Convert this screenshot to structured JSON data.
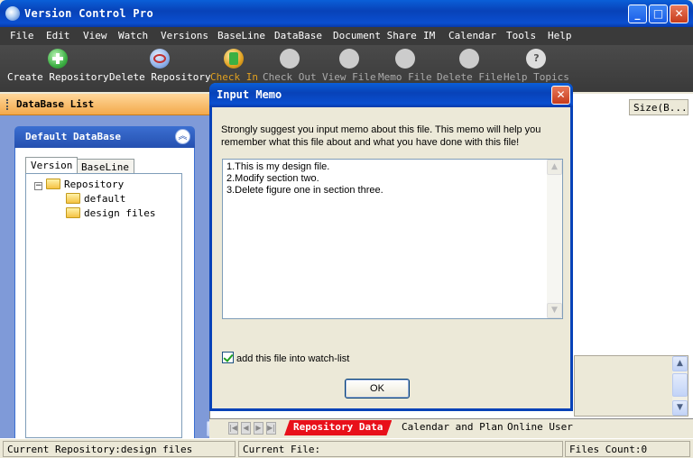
{
  "window": {
    "title": "Version Control Pro",
    "min_label": "_",
    "max_label": "□",
    "close_label": "✕"
  },
  "menu": [
    "File",
    "Edit",
    "View",
    "Watch",
    "Versions",
    "BaseLine",
    "DataBase",
    "Document Share",
    "IM",
    "Calendar",
    "Tools",
    "Help"
  ],
  "toolbar": [
    {
      "label": "Create Repository",
      "icon": "plus-icon",
      "color": "#3cb043"
    },
    {
      "label": "Delete Repository",
      "icon": "delete-icon",
      "color": "#4a78c8"
    },
    {
      "label": "Check In",
      "icon": "check-in-icon",
      "color": "#e0a020"
    },
    {
      "label": "Check Out",
      "icon": "check-out-icon",
      "color": "#bbbbbb"
    },
    {
      "label": "View File",
      "icon": "view-file-icon",
      "color": "#bbbbbb"
    },
    {
      "label": "Memo File",
      "icon": "memo-file-icon",
      "color": "#bbbbbb"
    },
    {
      "label": "Delete File",
      "icon": "delete-file-icon",
      "color": "#bbbbbb"
    },
    {
      "label": "Help Topics",
      "icon": "help-icon",
      "color": "#bbbbbb"
    }
  ],
  "sidebar": {
    "header": "DataBase List",
    "panel_title": "Default DataBase",
    "tabs": [
      "Version",
      "BaseLine"
    ],
    "tree": {
      "root": "Repository",
      "children": [
        "default",
        "design files"
      ]
    }
  },
  "main": {
    "column_header": "Size(B...",
    "tabs": [
      "Repository Data",
      "Calendar and Plan",
      "Online User"
    ]
  },
  "status": {
    "repo": "Current Repository:design files",
    "file": "Current File:",
    "count": "Files Count:0"
  },
  "dialog": {
    "title": "Input Memo",
    "message": "Strongly suggest you input memo about this file. This memo will help you remember what this file about and what you have done with this file!",
    "memo_lines": [
      "1.This is my design file.",
      "2.Modify section two.",
      "3.Delete figure one in section three."
    ],
    "checkbox_label": "add this file into watch-list",
    "checkbox_checked": true,
    "ok_label": "OK"
  }
}
